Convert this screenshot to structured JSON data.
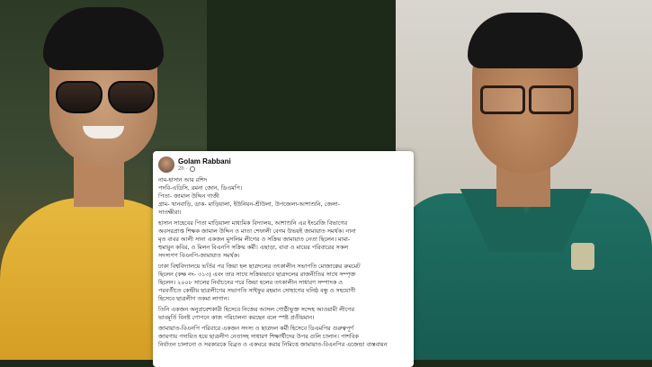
{
  "post": {
    "author": "Golam Rabbani",
    "time": "2h",
    "globe_icon": "globe-icon",
    "lines": [
      "নাম-হাসান আর রশিদ",
      "পদবি-এডিসি, রমনা জোন, ডিএমপি।",
      "পিতা- জামাল উদ্দিন গাজী",
      "গ্রাম- খানবাড়ি, ডাক- মাড়িয়ালা, ইউনিয়ন-শ্রীউলা, উপজেলা-আশাশুনি, জেলা-",
      "সাতক্ষীরা।"
    ],
    "paragraph1": [
      "হাসান সাহেবের পিতা মাড়িয়ালা মাধ্যমিক বিদ্যালয়, আশাশুনি এর ইংরেজি বিভাগের",
      "অবসরপ্রাপ্ত শিক্ষক জামাল উদ্দিন ও মাতা শেফালী বেগম উভয়ই জামায়াত সমর্থক। নানা",
      "মৃত বাবর আলী সানা একজন মুসলিম লীগের ও সক্রিয় জামায়াত নেতা ছিলেন। মামা-",
      "হুমায়ুন কবির, ও মিলন বিএনপি সক্রিয় কর্মী। এছাড়া, বাবা ও মায়ের পরিবারের সকল",
      "সদস্যগণ বিএনপি-জামায়াত সমর্থক।"
    ],
    "paragraph2": [
      "ঢাকা বিশ্ববিদ্যালয়ে ভর্তির পর জিয়া হল ছাত্রদলের তৎকালীন সভাপতি মোজাক্কের রুমমেট",
      "ছিলেন (কক্ষ নং- ৩১৩) এবং তার সাথে সক্রিয়ভাবে ছাত্রদলের রাজনীতির সাথে সম্পৃক্ত",
      "ছিলেন। ২০০৮ সালের নির্বাচনের পরে জিয়া হলের তৎকালীন সাধারণ সম্পাদক ও",
      "পরবর্তীতে কেন্দ্রীয় ছাত্রলীগের সভাপতি সাইফুর রহমান সোহাগের ঘনিষ্ঠ বন্ধু ও সহযোগী",
      "হিসেবে ছাত্রলীগ তকমা লাগান।"
    ],
    "paragraph3": [
      "তিনি একজন অনুপ্রবেশকারী হিসেবে নিজের আসল গোষ্ঠীভুক্ত সন্দেহ আওয়ামী লীগের",
      "ভাবমূর্তি বিনষ্ট গোপনে কাজ পরিচালনা করছেন বলে স্পষ্ট প্রতীয়মান।"
    ],
    "paragraph4": [
      "জামায়াত-বিএনপি পরিবারে একজন সদস্য ও ছাত্রদল কর্মী হিসেবে ডিএমপির গুরুত্বপূর্ণ",
      "জায়গায় পদায়িত হয়ে ছাত্রলীগ নেতাসহ সাধারণ শিক্ষার্থীদের উপর গুলি চালান। পাশবিক",
      "নির্যাতন চালানো ও সরকারকে বিব্রত ও একঘরে করার নিমিত্তে জামায়াত-বিএনপির এজেন্ডা বাস্তবায়ন"
    ]
  }
}
